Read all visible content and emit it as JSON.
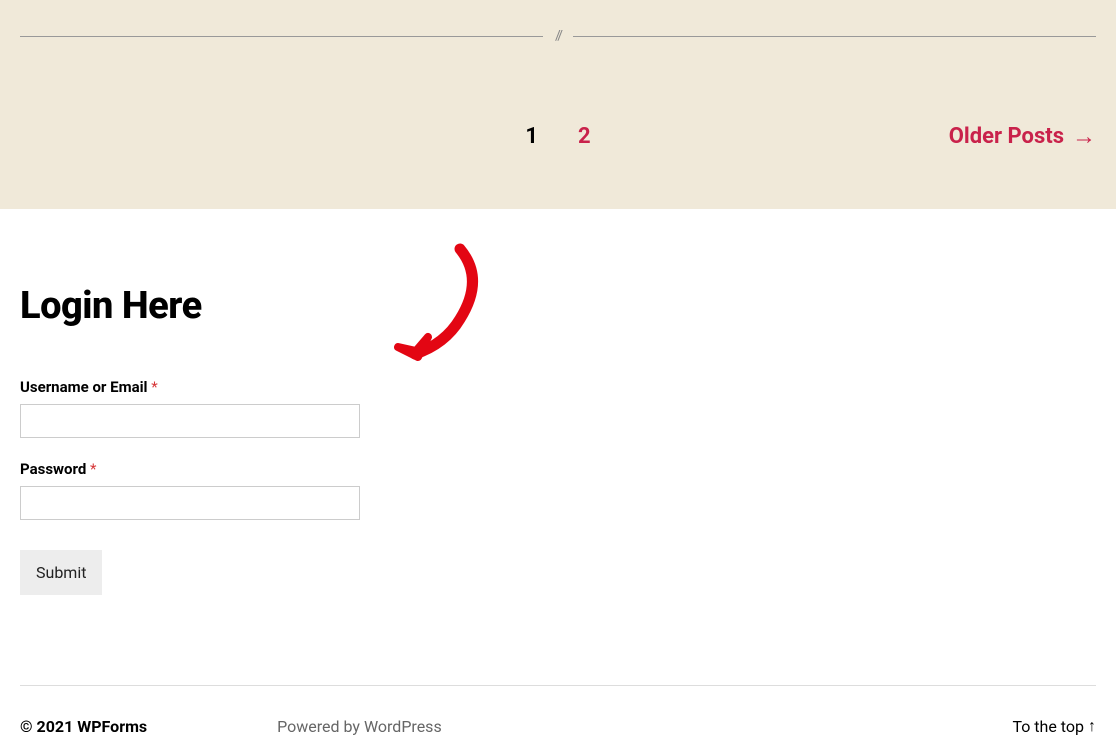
{
  "pagination": {
    "current": "1",
    "next": "2",
    "older_posts": "Older Posts"
  },
  "login": {
    "heading": "Login Here",
    "username_label": "Username or Email",
    "password_label": "Password",
    "required_marker": "*",
    "submit_label": "Submit"
  },
  "footer": {
    "copyright": "© 2021 WPForms",
    "powered_by": "Powered by WordPress",
    "to_top": "To the top"
  },
  "divider": {
    "slashes": "//"
  }
}
